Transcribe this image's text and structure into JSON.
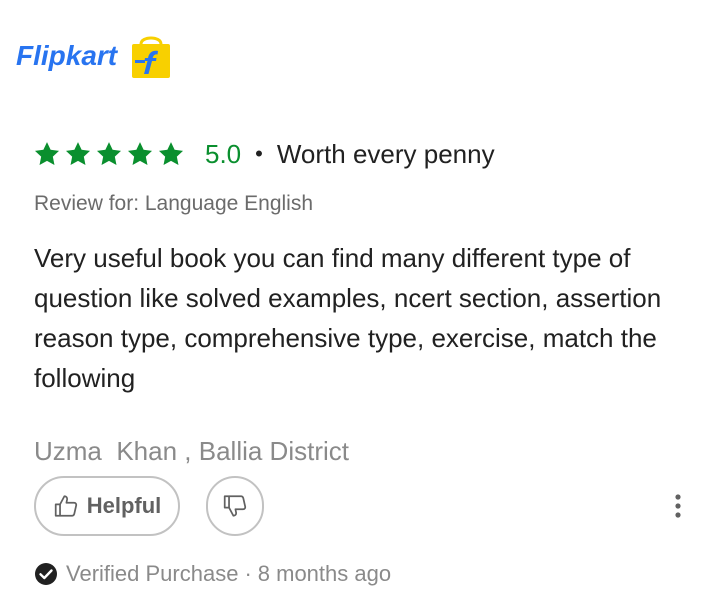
{
  "brand": {
    "name": "Flipkart",
    "logo_icon": "flipkart-bag-icon",
    "colors": {
      "primary": "#2874f0",
      "logo_bag": "#f8d000"
    }
  },
  "review": {
    "rating_value": "5.0",
    "stars": 5,
    "separator": "•",
    "title": "Worth every penny",
    "review_for": "Review for: Language English",
    "text": "Very useful book you can find many different type of question like solved examples, ncert section, assertion reason type, comprehensive type, exercise, match the following",
    "author": "Uzma  Khan , Ballia District",
    "colors": {
      "star": "#0a8f2e",
      "rating": "#0a8f2e"
    }
  },
  "actions": {
    "helpful_label": "Helpful",
    "helpful_icon": "thumbs-up-icon",
    "dislike_icon": "thumbs-down-icon",
    "more_icon": "more-vertical-icon"
  },
  "verified": {
    "icon": "check-circle-icon",
    "label": "Verified Purchase",
    "separator": "·",
    "time": "8 months ago"
  }
}
